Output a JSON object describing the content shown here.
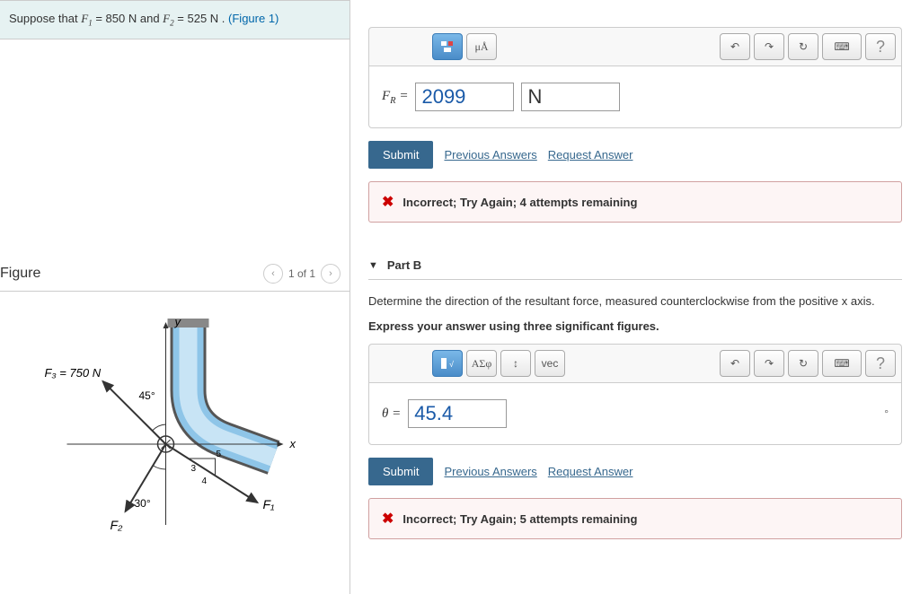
{
  "problem": {
    "text_prefix": "Suppose that ",
    "f1_label": "F",
    "f1_sub": "1",
    "f1_val": " = 850  N",
    "and": " and ",
    "f2_label": "F",
    "f2_sub": "2",
    "f2_val": " = 525  N",
    "suffix": " . ",
    "figure_link": "(Figure 1)"
  },
  "figure": {
    "title": "Figure",
    "nav_text": "1 of 1",
    "f3_label": "F₃ = 750 N",
    "angle_45": "45°",
    "angle_30": "30°",
    "f1_lbl": "F₁",
    "f2_lbl": "F₂",
    "x_lbl": "x",
    "y_lbl": "y",
    "tri_5": "5",
    "tri_4": "4",
    "tri_3": "3"
  },
  "partA": {
    "toolbar": {
      "ua": "μÅ",
      "q": "?"
    },
    "label_pre": "F",
    "label_sub": "R",
    "label_post": " = ",
    "value": "2099",
    "unit": "N",
    "submit": "Submit",
    "prev": "Previous Answers",
    "req": "Request Answer",
    "feedback": "Incorrect; Try Again; 4 attempts remaining"
  },
  "partB": {
    "header": "Part B",
    "instruction1": "Determine the direction of the resultant force, measured counterclockwise from the positive x axis.",
    "instruction2": "Express your answer using three significant figures.",
    "toolbar": {
      "greek": "ΑΣφ",
      "vec": "vec",
      "q": "?"
    },
    "label": "θ = ",
    "value": "45.4",
    "unit": "°",
    "submit": "Submit",
    "prev": "Previous Answers",
    "req": "Request Answer",
    "feedback": "Incorrect; Try Again; 5 attempts remaining"
  }
}
